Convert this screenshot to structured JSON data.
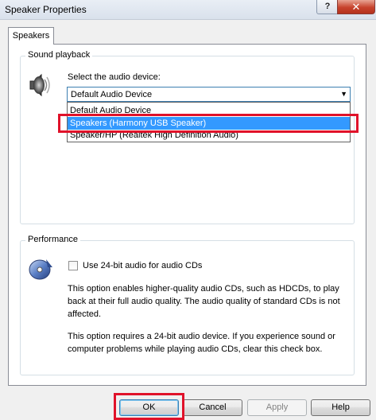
{
  "window": {
    "title": "Speaker Properties",
    "help_glyph": "?",
    "close_glyph": "✕"
  },
  "tabs": [
    {
      "label": "Speakers"
    }
  ],
  "sound_playback": {
    "group_title": "Sound playback",
    "select_label": "Select the audio device:",
    "selected_value": "Default Audio Device",
    "options": [
      "Default Audio Device",
      "Speakers (Harmony USB Speaker)",
      "Speaker/HP (Realtek High Definition Audio)"
    ]
  },
  "performance": {
    "group_title": "Performance",
    "checkbox_label": "Use 24-bit audio for audio CDs",
    "checkbox_checked": false,
    "description_1": "This option enables higher-quality audio CDs, such as HDCDs, to play back at their full audio quality. The audio quality of standard CDs is not affected.",
    "description_2": "This option requires a 24-bit audio device. If you experience sound or computer problems while playing audio CDs, clear this check box."
  },
  "buttons": {
    "ok": "OK",
    "cancel": "Cancel",
    "apply": "Apply",
    "help": "Help"
  },
  "colors": {
    "highlight_box": "#e0122a",
    "selection": "#3399ff"
  }
}
